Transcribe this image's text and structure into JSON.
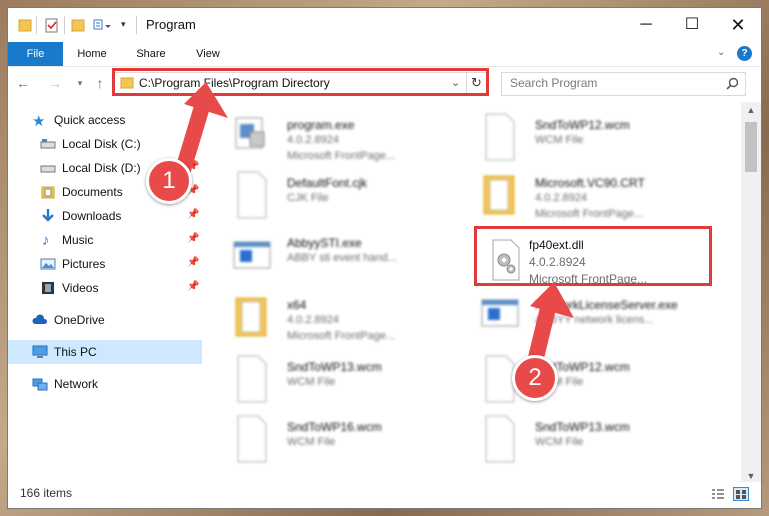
{
  "window": {
    "title": "Program"
  },
  "ribbon": {
    "tabs": [
      "File",
      "Home",
      "Share",
      "View"
    ]
  },
  "address": {
    "path": "C:\\Program Files\\Program Directory"
  },
  "search": {
    "placeholder": "Search Program"
  },
  "sidebar": {
    "items": [
      {
        "label": "Quick access"
      },
      {
        "label": "Local Disk (C:)"
      },
      {
        "label": "Local Disk (D:)"
      },
      {
        "label": "Documents"
      },
      {
        "label": "Downloads"
      },
      {
        "label": "Music"
      },
      {
        "label": "Pictures"
      },
      {
        "label": "Videos"
      },
      {
        "label": "OneDrive"
      },
      {
        "label": "This PC"
      },
      {
        "label": "Network"
      }
    ]
  },
  "files": [
    {
      "name": "program.exe",
      "line1": "4.0.2.8924",
      "line2": "Microsoft FrontPage..."
    },
    {
      "name": "SndToWP12.wcm",
      "line1": "WCM File",
      "line2": ""
    },
    {
      "name": "DefaultFont.cjk",
      "line1": "CJK File",
      "line2": ""
    },
    {
      "name": "Microsoft.VC90.CRT",
      "line1": "4.0.2.8924",
      "line2": "Microsoft FrontPage..."
    },
    {
      "name": "AbbyySTI.exe",
      "line1": "ABBY sti event hand...",
      "line2": ""
    },
    {
      "name": "fp40ext.dll",
      "line1": "4.0.2.8924",
      "line2": "Microsoft FrontPage..."
    },
    {
      "name": "x64",
      "line1": "4.0.2.8924",
      "line2": "Microsoft FrontPage..."
    },
    {
      "name": "NetworkLicenseServer.exe",
      "line1": "ABBYY network licens...",
      "line2": ""
    },
    {
      "name": "SndToWP13.wcm",
      "line1": "WCM File",
      "line2": ""
    },
    {
      "name": "SndToWP12.wcm",
      "line1": "WCM File",
      "line2": ""
    },
    {
      "name": "SndToWP16.wcm",
      "line1": "WCM File",
      "line2": ""
    },
    {
      "name": "SndToWP13.wcm",
      "line1": "WCM File",
      "line2": ""
    }
  ],
  "status": {
    "items_count": "166 items"
  },
  "annotations": {
    "badge1": "1",
    "badge2": "2"
  },
  "colors": {
    "accent": "#1979ca",
    "highlight": "#e03a3a",
    "selected": "#cde8ff"
  }
}
